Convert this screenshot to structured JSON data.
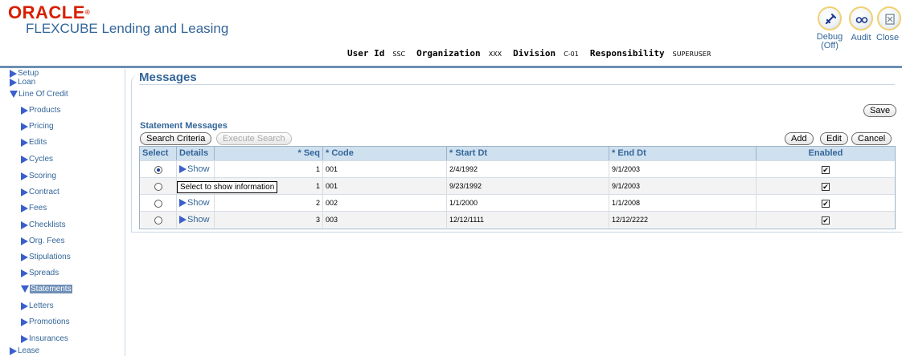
{
  "brand": {
    "company": "ORACLE",
    "product": "FLEXCUBE Lending and Leasing"
  },
  "userbar": {
    "user_label": "User Id",
    "user_value": "SSC",
    "org_label": "Organization",
    "org_value": "XXX",
    "div_label": "Division",
    "div_value": "C-01",
    "resp_label": "Responsibility",
    "resp_value": "SUPERUSER"
  },
  "global_buttons": {
    "debug_label": "Debug",
    "debug_state": "(Off)",
    "audit_label": "Audit",
    "close_label": "Close"
  },
  "sidebar": {
    "items": [
      {
        "label": "Setup",
        "expanded": false
      },
      {
        "label": "Loan",
        "expanded": false
      },
      {
        "label": "Line Of Credit",
        "expanded": true
      },
      {
        "label": "Products"
      },
      {
        "label": "Pricing"
      },
      {
        "label": "Edits"
      },
      {
        "label": "Cycles"
      },
      {
        "label": "Scoring"
      },
      {
        "label": "Contract"
      },
      {
        "label": "Fees"
      },
      {
        "label": "Checklists"
      },
      {
        "label": "Org. Fees"
      },
      {
        "label": "Stipulations"
      },
      {
        "label": "Spreads"
      },
      {
        "label": "Statements",
        "selected": true
      },
      {
        "label": "Letters"
      },
      {
        "label": "Promotions"
      },
      {
        "label": "Insurances"
      },
      {
        "label": "Lease",
        "expanded": false
      }
    ]
  },
  "page": {
    "title": "Messages",
    "save_label": "Save",
    "section_title": "Statement Messages",
    "search_criteria_label": "Search Criteria",
    "execute_search_label": "Execute Search",
    "add_label": "Add",
    "edit_label": "Edit",
    "cancel_label": "Cancel"
  },
  "table": {
    "headers": {
      "select": "Select",
      "details": "Details",
      "seq": "* Seq",
      "code": "* Code",
      "start_dt": "* Start Dt",
      "end_dt": "* End Dt",
      "enabled": "Enabled"
    },
    "rows": [
      {
        "selected": true,
        "details": "Show",
        "seq": "1",
        "code": "001",
        "start_dt": "2/4/1992",
        "end_dt": "9/1/2003",
        "enabled": true
      },
      {
        "selected": false,
        "details": "Show",
        "seq": "1",
        "code": "001",
        "start_dt": "9/23/1992",
        "end_dt": "9/1/2003",
        "enabled": true
      },
      {
        "selected": false,
        "details": "Show",
        "seq": "2",
        "code": "002",
        "start_dt": "1/1/2000",
        "end_dt": "1/1/2008",
        "enabled": true
      },
      {
        "selected": false,
        "details": "Show",
        "seq": "3",
        "code": "003",
        "start_dt": "12/12/1111",
        "end_dt": "12/12/2222",
        "enabled": true
      }
    ]
  },
  "tooltip": "Select to show information"
}
